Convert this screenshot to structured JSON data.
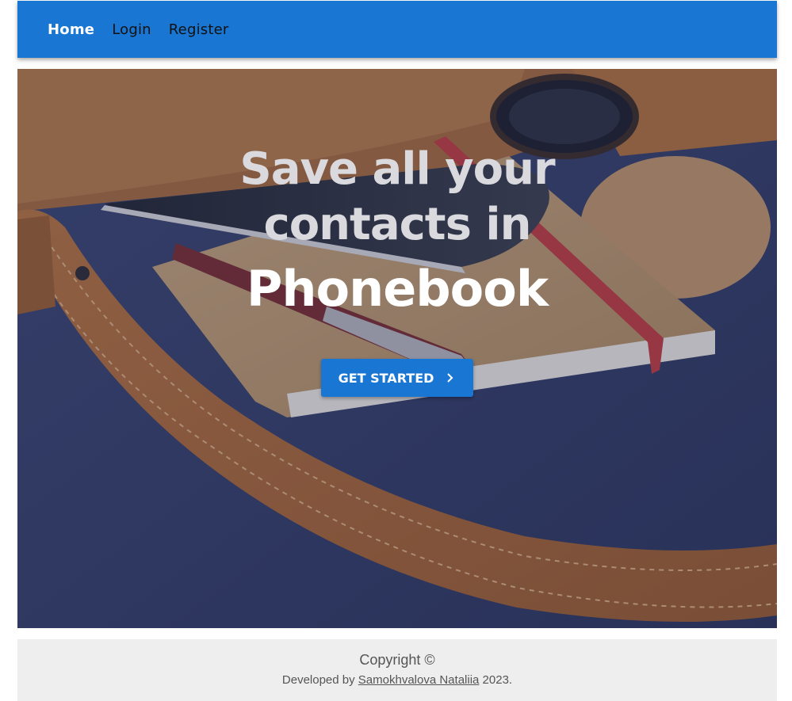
{
  "nav": {
    "items": [
      {
        "label": "Home",
        "active": true
      },
      {
        "label": "Login",
        "active": false
      },
      {
        "label": "Register",
        "active": false
      }
    ]
  },
  "hero": {
    "line1": "Save all your",
    "line2": "contacts in",
    "line3": "Phonebook",
    "cta_label": "GET STARTED",
    "cta_icon": "chevron-right-icon"
  },
  "footer": {
    "copyright": "Copyright ©",
    "developed_by": "Developed by",
    "author": "Samokhvalova Nataliia",
    "year": "2023."
  },
  "colors": {
    "primary": "#1976d2",
    "footer_bg": "#eeeeee",
    "hero_text": "#d9d9de"
  }
}
